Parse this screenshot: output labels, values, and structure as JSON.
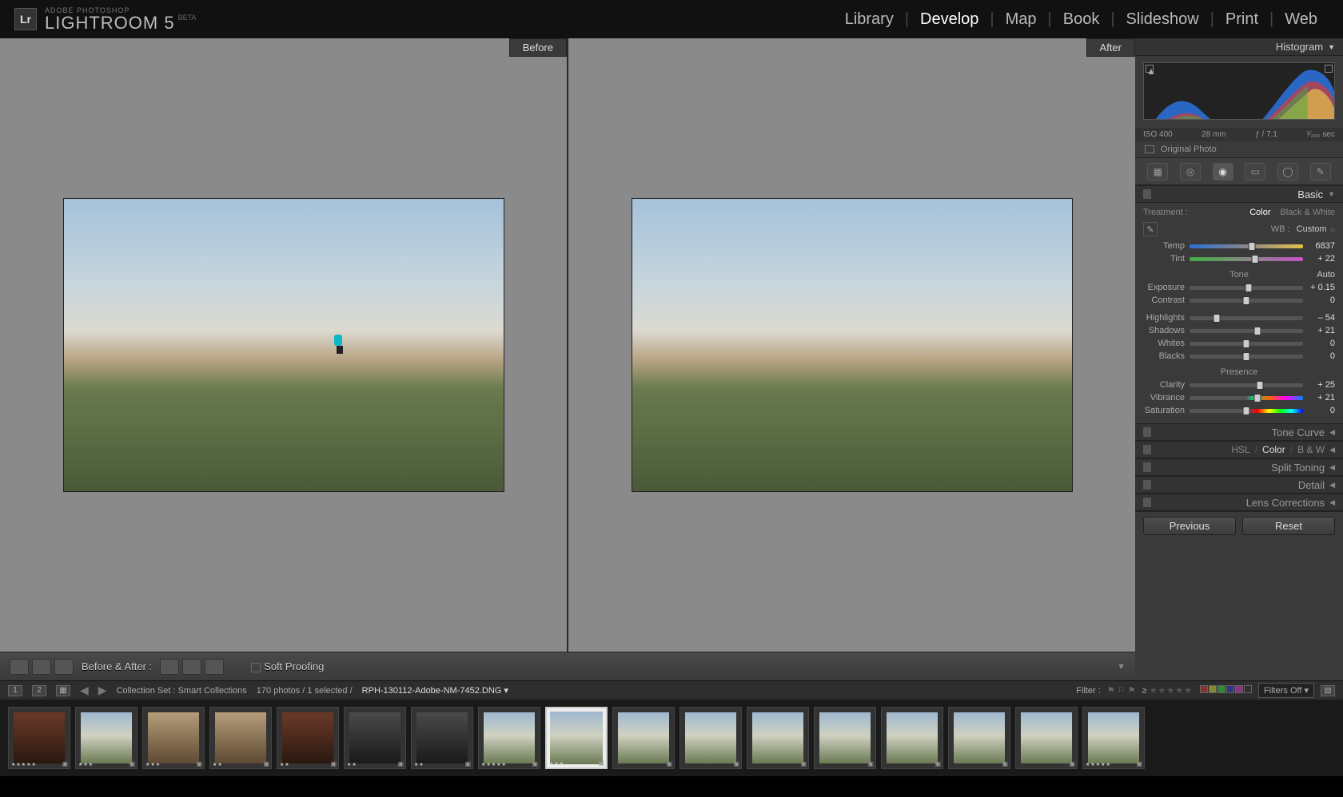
{
  "brand": {
    "vendor": "ADOBE PHOTOSHOP",
    "product": "LIGHTROOM 5",
    "beta": "BETA",
    "logo": "Lr"
  },
  "modules": [
    "Library",
    "Develop",
    "Map",
    "Book",
    "Slideshow",
    "Print",
    "Web"
  ],
  "active_module": "Develop",
  "compare": {
    "before": "Before",
    "after": "After"
  },
  "toolbar": {
    "before_after_label": "Before & After :",
    "soft_proofing": "Soft Proofing"
  },
  "right": {
    "histogram_title": "Histogram",
    "meta": {
      "iso": "ISO 400",
      "focal": "28 mm",
      "aperture": "ƒ / 7.1",
      "shutter": "¹⁄₂₀₀ sec"
    },
    "original_photo": "Original Photo",
    "basic_title": "Basic",
    "treatment_label": "Treatment :",
    "treatment_options": [
      "Color",
      "Black & White"
    ],
    "treatment_active": "Color",
    "wb_label": "WB :",
    "wb_value": "Custom",
    "sliders": {
      "temp": {
        "label": "Temp",
        "value": "6837",
        "pos": 55
      },
      "tint": {
        "label": "Tint",
        "value": "+ 22",
        "pos": 58
      },
      "exposure": {
        "label": "Exposure",
        "value": "+ 0.15",
        "pos": 52
      },
      "contrast": {
        "label": "Contrast",
        "value": "0",
        "pos": 50
      },
      "highlights": {
        "label": "Highlights",
        "value": "– 54",
        "pos": 24
      },
      "shadows": {
        "label": "Shadows",
        "value": "+ 21",
        "pos": 60
      },
      "whites": {
        "label": "Whites",
        "value": "0",
        "pos": 50
      },
      "blacks": {
        "label": "Blacks",
        "value": "0",
        "pos": 50
      },
      "clarity": {
        "label": "Clarity",
        "value": "+ 25",
        "pos": 62
      },
      "vibrance": {
        "label": "Vibrance",
        "value": "+ 21",
        "pos": 60
      },
      "saturation": {
        "label": "Saturation",
        "value": "0",
        "pos": 50
      }
    },
    "tone_title": "Tone",
    "tone_auto": "Auto",
    "presence_title": "Presence",
    "panels": {
      "tone_curve": "Tone Curve",
      "hsl": "HSL",
      "color": "Color",
      "bw": "B & W",
      "split_toning": "Split Toning",
      "detail": "Detail",
      "lens": "Lens Corrections"
    },
    "previous": "Previous",
    "reset": "Reset"
  },
  "infobar": {
    "view1": "1",
    "view2": "2",
    "collection": "Collection Set : Smart Collections",
    "count": "170 photos / 1 selected /",
    "filename": "RPH-130112-Adobe-NM-7452.DNG",
    "filter_label": "Filter :",
    "filters_off": "Filters Off"
  },
  "thumbs": [
    {
      "cls": "gear",
      "stars": "★★★★★"
    },
    {
      "cls": "",
      "stars": "★★★"
    },
    {
      "cls": "city",
      "stars": "★★★"
    },
    {
      "cls": "city",
      "stars": "★★"
    },
    {
      "cls": "gear",
      "stars": "★★"
    },
    {
      "cls": "dark",
      "stars": "★★"
    },
    {
      "cls": "dark",
      "stars": "★★"
    },
    {
      "cls": "",
      "stars": "★★★★★"
    },
    {
      "cls": "selected",
      "stars": "★★★"
    },
    {
      "cls": "",
      "stars": ""
    },
    {
      "cls": "",
      "stars": ""
    },
    {
      "cls": "",
      "stars": ""
    },
    {
      "cls": "",
      "stars": ""
    },
    {
      "cls": "",
      "stars": ""
    },
    {
      "cls": "",
      "stars": ""
    },
    {
      "cls": "",
      "stars": ""
    },
    {
      "cls": "",
      "stars": "★★★★★"
    }
  ]
}
